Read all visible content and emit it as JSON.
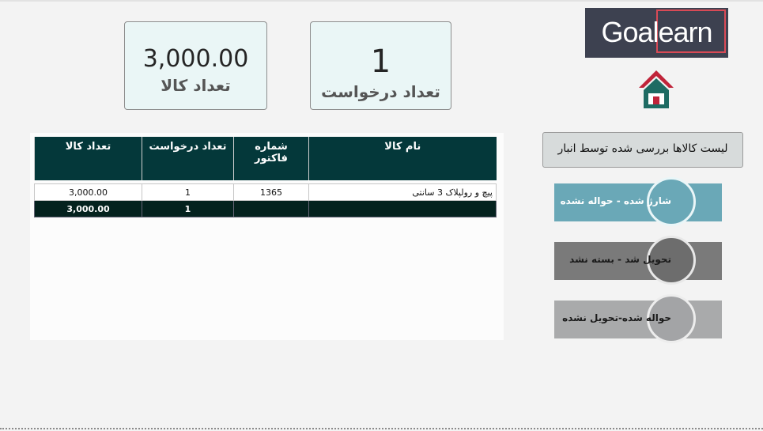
{
  "kpis": {
    "total_qty": {
      "value": "3,000.00",
      "label": "تعداد کالا"
    },
    "request_count": {
      "value": "1",
      "label": "تعداد درخواست"
    }
  },
  "logo": {
    "text": "Goalearn"
  },
  "panel": {
    "title": "لیست کالاها بررسی شده توسط انبار"
  },
  "statuses": [
    {
      "label": "شارژ شده - حواله نشده",
      "color": "#6aa8b7"
    },
    {
      "label": "تحویل شد - بسته نشد",
      "color": "#7a7a7a"
    },
    {
      "label": "حواله شده-تحویل نشده",
      "color": "#a9aaab"
    }
  ],
  "table": {
    "headers": {
      "item_name": "نام کالا",
      "invoice_no": "شماره فاکتور",
      "req_count": "تعداد درخواست",
      "qty": "تعداد کالا"
    },
    "rows": [
      {
        "item_name": "پیچ و رولپلاک 3 سانتی",
        "invoice_no": "1365",
        "req_count": "1",
        "qty": "3,000.00"
      }
    ],
    "total": {
      "req_count": "1",
      "qty": "3,000.00"
    }
  },
  "icons": {
    "home": "home-icon"
  },
  "colors": {
    "header": "#04383a",
    "total_row": "#04221e",
    "accent_red": "#c0243a"
  }
}
